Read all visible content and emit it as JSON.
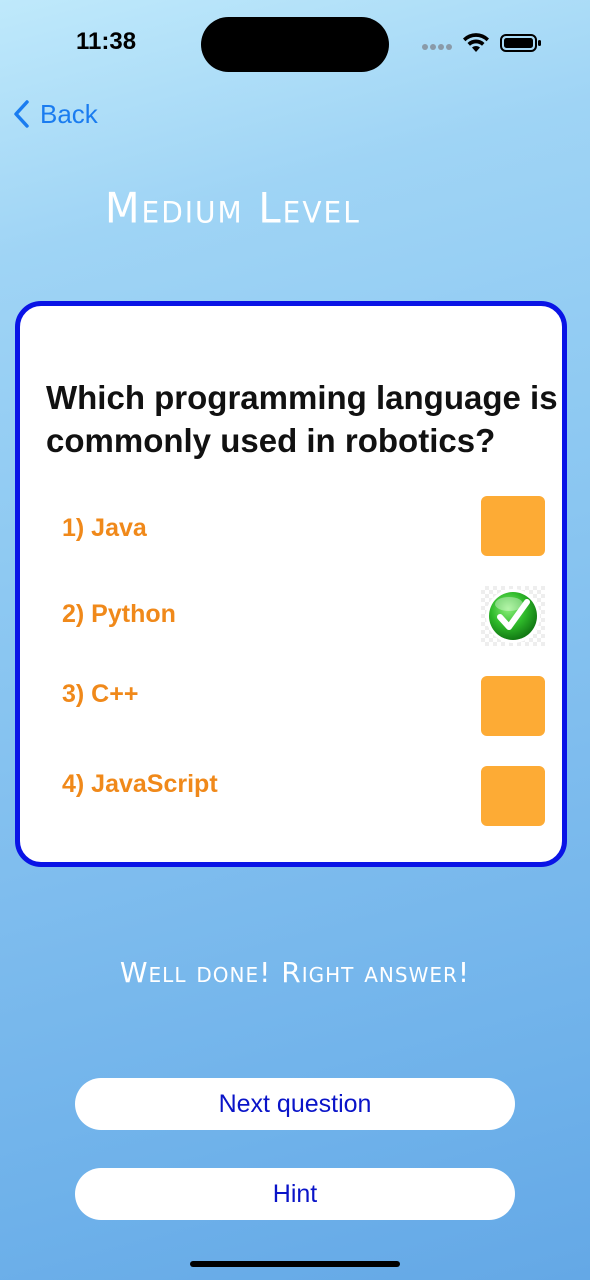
{
  "status_bar": {
    "time": "11:38"
  },
  "nav": {
    "back_label": "Back"
  },
  "level": {
    "title": "Medium Level"
  },
  "quiz": {
    "question": "Which programming language is commonly used in robotics?",
    "options": [
      {
        "label": "1) Java",
        "state": "unchecked"
      },
      {
        "label": "2) Python",
        "state": "correct"
      },
      {
        "label": "3) C++",
        "state": "unchecked"
      },
      {
        "label": "4) JavaScript",
        "state": "unchecked"
      }
    ]
  },
  "feedback": {
    "message": "Well done! Right answer!"
  },
  "actions": {
    "next_label": "Next question",
    "hint_label": "Hint"
  },
  "colors": {
    "accent_blue": "#0a14e6",
    "option_orange": "#f0891a",
    "checkbox_orange": "#fdab35",
    "back_blue": "#1a7cf0"
  }
}
